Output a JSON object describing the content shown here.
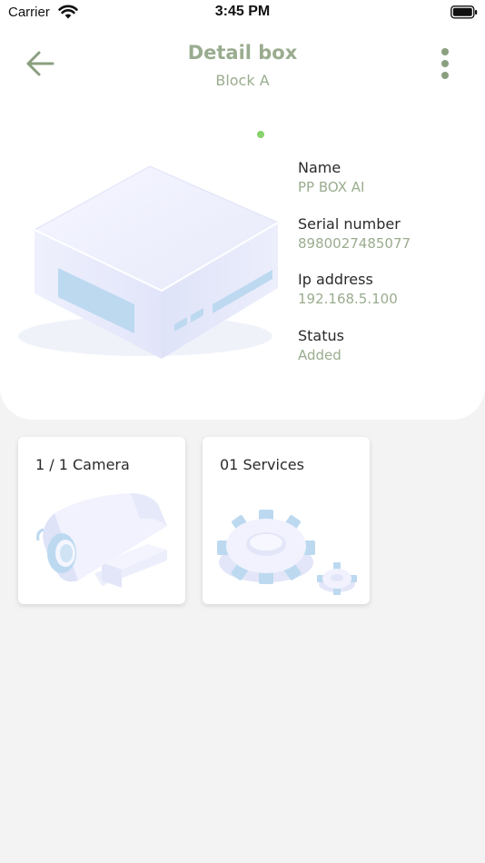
{
  "status_bar": {
    "carrier": "Carrier",
    "time": "3:45 PM"
  },
  "header": {
    "title": "Detail box",
    "subtitle": "Block A",
    "back_icon": "arrow-left-icon",
    "menu_icon": "more-vertical-icon"
  },
  "device": {
    "online_indicator_color": "#86d36a",
    "illustration": "mini-pc-box-illustration",
    "fields": [
      {
        "label": "Name",
        "value": "PP BOX AI"
      },
      {
        "label": "Serial number",
        "value": "8980027485077"
      },
      {
        "label": "Ip address",
        "value": "192.168.5.100"
      },
      {
        "label": "Status",
        "value": "Added"
      }
    ]
  },
  "tiles": [
    {
      "label": "1 / 1 Camera",
      "illustration": "camera-illustration"
    },
    {
      "label": "01 Services",
      "illustration": "gears-illustration"
    }
  ],
  "colors": {
    "accent": "#9aac8f",
    "background": "#f3f3f3",
    "card": "#ffffff"
  }
}
